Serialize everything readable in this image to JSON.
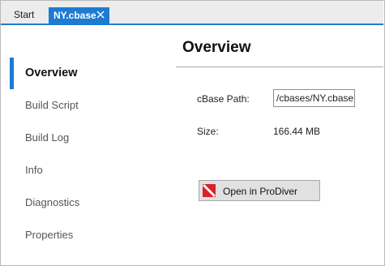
{
  "tabs": [
    {
      "label": "Start"
    },
    {
      "label": "NY.cbase"
    }
  ],
  "accent_color": "#1e7bd2",
  "sidebar": {
    "items": [
      {
        "label": "Overview"
      },
      {
        "label": "Build Script"
      },
      {
        "label": "Build Log"
      },
      {
        "label": "Info"
      },
      {
        "label": "Diagnostics"
      },
      {
        "label": "Properties"
      }
    ],
    "active_index": 0
  },
  "main": {
    "title": "Overview",
    "cbase_path_label": "cBase Path:",
    "cbase_path_value": "/cbases/NY.cbase",
    "size_label": "Size:",
    "size_value": "166.44 MB",
    "open_button_label": "Open in ProDiver",
    "open_button_icon": "prodiver-icon"
  }
}
